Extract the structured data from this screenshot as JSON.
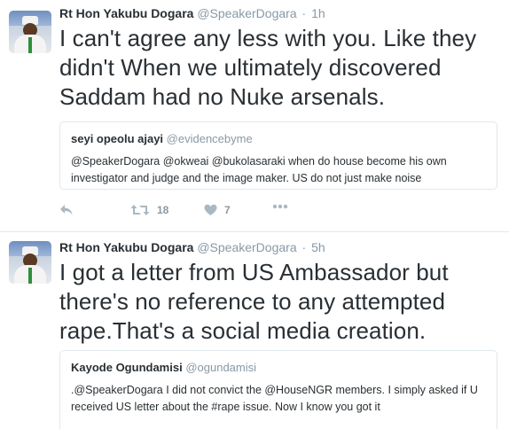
{
  "tweets": [
    {
      "name": "Rt Hon Yakubu Dogara",
      "handle": "@SpeakerDogara",
      "separator": "·",
      "time": "1h",
      "text": "I can't agree any less with you. Like they didn't When we ultimately discovered Saddam had no Nuke arsenals.",
      "quote": {
        "name": "seyi opeolu ajayi",
        "handle": "@evidencebyme",
        "text": "@SpeakerDogara @okweai @bukolasaraki when do house become his own investigator and judge and the image maker. US do not  just make noise"
      },
      "retweets": "18",
      "likes": "7"
    },
    {
      "name": "Rt Hon Yakubu Dogara",
      "handle": "@SpeakerDogara",
      "separator": "·",
      "time": "5h",
      "text": "I got a letter from US Ambassador but there's no reference to any attempted rape.That's a social media creation.",
      "quote": {
        "name": "Kayode Ogundamisi",
        "handle": "@ogundamisi",
        "text": ".@SpeakerDogara I did not convict the @HouseNGR members. I simply asked if U received US letter about the #rape issue. Now I know you got it"
      }
    }
  ],
  "icons": {
    "reply": "reply-icon",
    "retweet": "retweet-icon",
    "like": "heart-icon",
    "more": "more-icon"
  },
  "colors": {
    "text": "#292f33",
    "secondary": "#8899a6",
    "icon": "#aab8c2",
    "border": "#e1e8ed"
  }
}
